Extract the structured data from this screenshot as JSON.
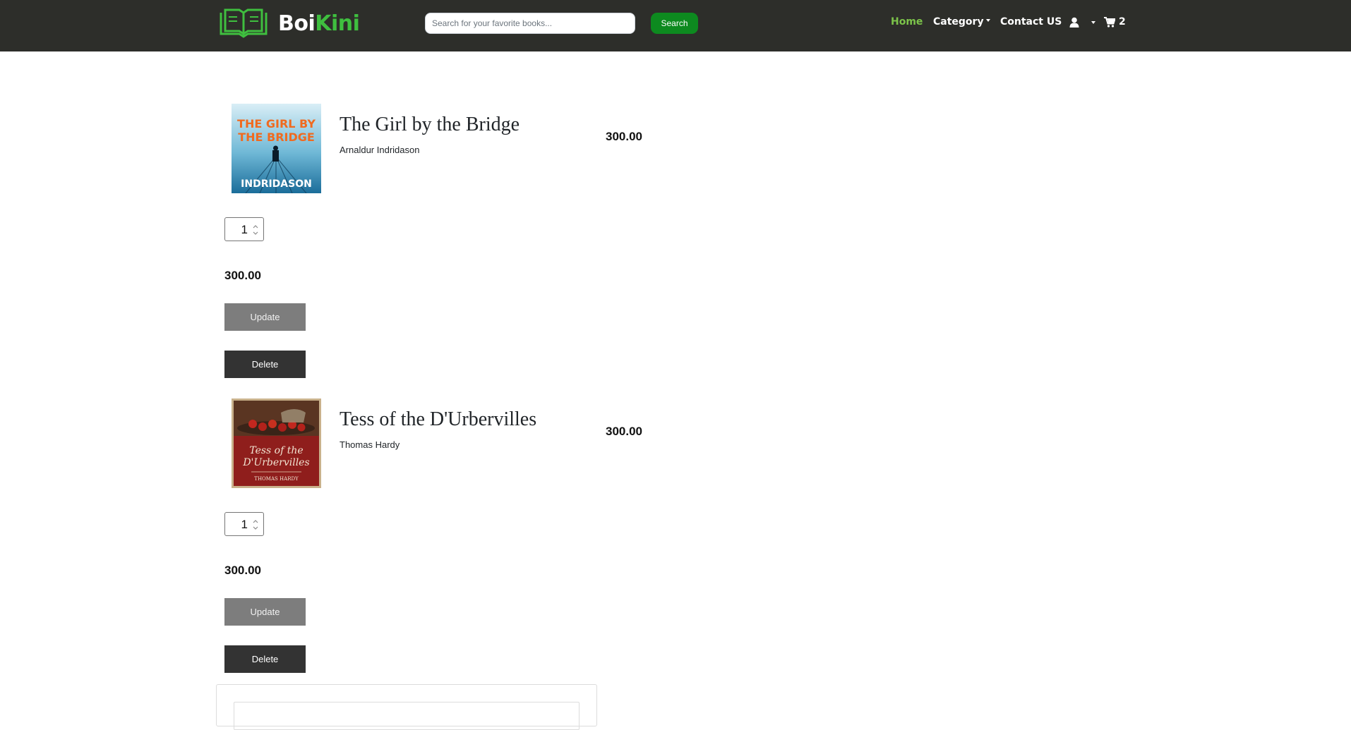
{
  "navbar": {
    "brand_part1": "Boi",
    "brand_part2": "Kini",
    "search_placeholder": "Search for your favorite books...",
    "search_button": "Search",
    "links": {
      "home": "Home",
      "category": "Category",
      "contact": "Contact US"
    },
    "cart_count": "2",
    "colors": {
      "background": "#2d2e2a",
      "brand_accent": "#3fbf3f",
      "active_link": "#7cc44a",
      "search_button": "#0d8a1f"
    }
  },
  "cart": {
    "items": [
      {
        "title": "The Girl by the Bridge",
        "author": "Arnaldur Indridason",
        "price": "300.00",
        "quantity": "1",
        "subtotal": "300.00",
        "update_label": "Update",
        "delete_label": "Delete",
        "cover": {
          "line1": "THE GIRL BY",
          "line2": "THE BRIDGE",
          "author_banner": "INDRIDASON"
        }
      },
      {
        "title": "Tess of the D'Urbervilles",
        "author": "Thomas Hardy",
        "price": "300.00",
        "quantity": "1",
        "subtotal": "300.00",
        "update_label": "Update",
        "delete_label": "Delete",
        "cover": {
          "line1": "Tess of the",
          "line2": "D'Urbervilles",
          "author_banner": "THOMAS HARDY"
        }
      }
    ]
  },
  "icons": {
    "logo": "open-book-logo-icon",
    "user": "user-icon",
    "cart": "shopping-cart-icon"
  }
}
